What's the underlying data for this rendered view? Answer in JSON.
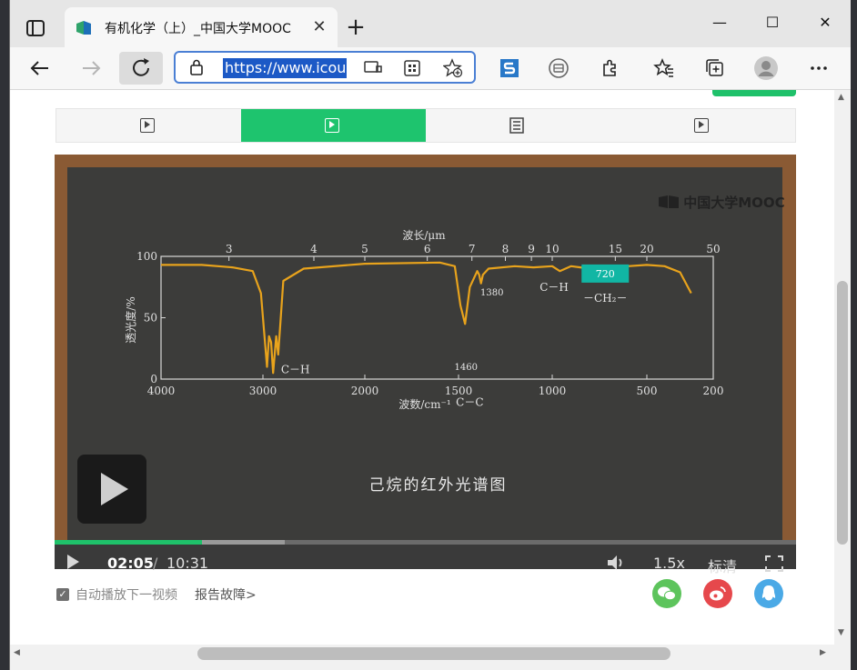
{
  "browser": {
    "tab_title": "有机化学（上）_中国大学MOOC",
    "address_url": "https://www.icour",
    "new_tab_label": "+",
    "tab_close_label": "✕"
  },
  "window_controls": {
    "minimize": "—",
    "maximize": "☐",
    "close": "✕"
  },
  "toolbar_icons": [
    "back-icon",
    "forward-icon",
    "refresh-icon",
    "lock-icon",
    "tablet-icon",
    "apps-icon",
    "add-favorite-icon",
    "s-extension-icon",
    "reader-extension-icon",
    "extensions-icon",
    "favorites-icon",
    "collections-icon",
    "profile-icon",
    "more-icon"
  ],
  "unit_tabs": [
    {
      "icon": "video-icon",
      "active": false
    },
    {
      "icon": "video-icon",
      "active": true
    },
    {
      "icon": "document-icon",
      "active": false
    },
    {
      "icon": "video-icon",
      "active": false
    }
  ],
  "video": {
    "watermark": "中国大学MOOC",
    "caption": "己烷的红外光谱图",
    "current_time": "02:05",
    "separator": "/",
    "duration": "10:31",
    "speed": "1.5x",
    "quality": "标清",
    "played_fraction": 0.199,
    "buffered_fraction": 0.31
  },
  "chart_data": {
    "type": "line",
    "title": "",
    "xlabel": "波数/cm⁻¹",
    "ylabel": "透光度/%",
    "top_axis_label": "波长/μm",
    "x_ticks": [
      "4000",
      "3000",
      "2000",
      "1500",
      "1000",
      "500",
      "200"
    ],
    "top_ticks": [
      "3",
      "4",
      "5",
      "6",
      "7",
      "8",
      "9",
      "10",
      "15",
      "20",
      "50"
    ],
    "y_ticks": [
      "0",
      "50",
      "100"
    ],
    "ylim": [
      0,
      100
    ],
    "series": [
      {
        "x": [
          4000,
          3600,
          3300,
          3100,
          3020,
          2960,
          2940,
          2920,
          2900,
          2870,
          2850,
          2800,
          2600,
          2000,
          1600,
          1520,
          1490,
          1465,
          1440,
          1400,
          1390,
          1380,
          1370,
          1340,
          1200,
          1100,
          1000,
          960,
          900,
          800,
          720,
          600,
          500,
          420,
          350,
          300
        ],
        "y": [
          93,
          93,
          91,
          88,
          70,
          10,
          35,
          30,
          5,
          35,
          20,
          80,
          90,
          94,
          95,
          92,
          60,
          45,
          75,
          88,
          85,
          78,
          85,
          90,
          92,
          91,
          92,
          88,
          92,
          90,
          91,
          92,
          93,
          92,
          87,
          70
        ]
      }
    ],
    "annotations": [
      "C－H",
      "1460",
      "1380",
      "C－C",
      "C－H",
      "720",
      "－CH₂－"
    ],
    "grid": false,
    "legend": "none"
  },
  "below_video": {
    "autoplay_label": "自动播放下一视频",
    "report_link": "报告故障>",
    "share": [
      {
        "icon": "wechat-icon",
        "color": "#5dc45c"
      },
      {
        "icon": "weibo-icon",
        "color": "#e6484c"
      },
      {
        "icon": "qq-icon",
        "color": "#4aa9e6"
      }
    ]
  }
}
